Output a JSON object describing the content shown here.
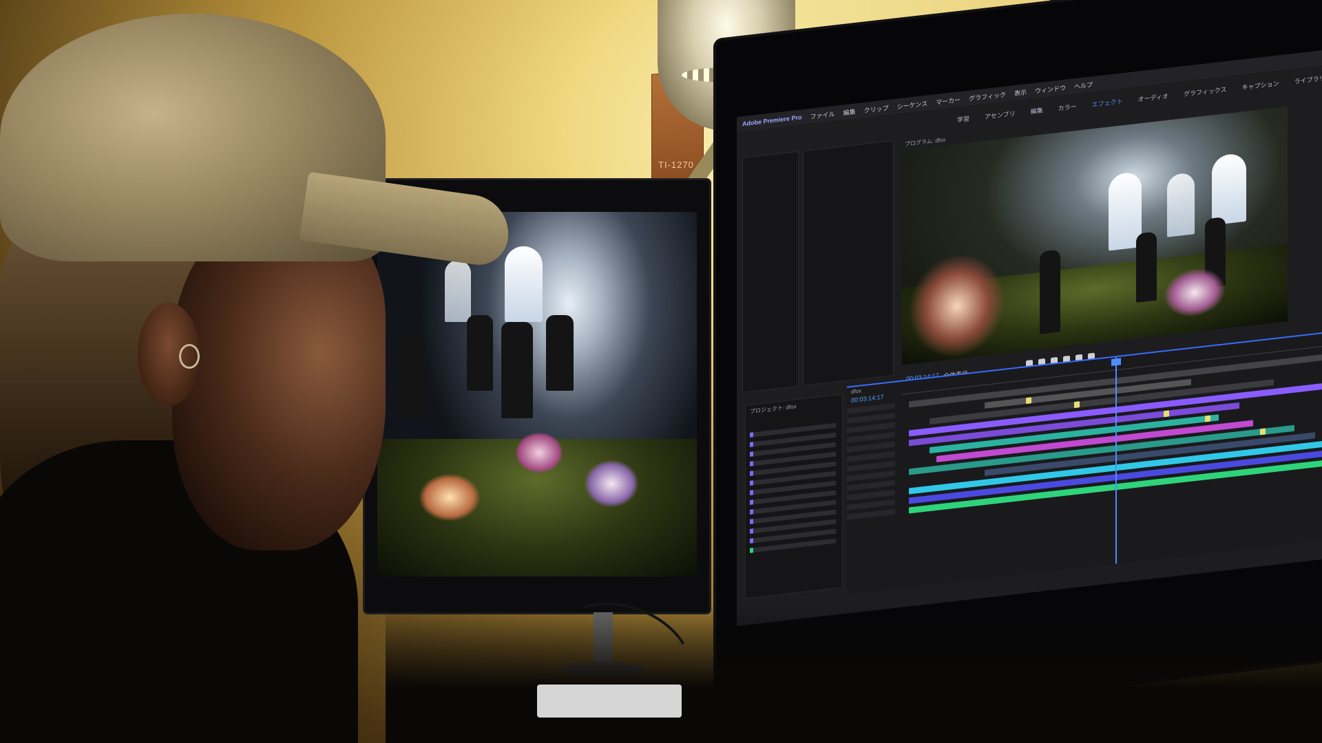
{
  "poster": {
    "code": "TI-1270"
  },
  "editor": {
    "app_name": "Adobe Premiere Pro",
    "menu": [
      "ファイル",
      "編集",
      "クリップ",
      "シーケンス",
      "マーカー",
      "グラフィック",
      "表示",
      "ウィンドウ",
      "ヘルプ"
    ],
    "workspace_tabs": [
      "学習",
      "アセンブリ",
      "編集",
      "カラー",
      "エフェクト",
      "オーディオ",
      "グラフィックス",
      "キャプション",
      "ライブラリ"
    ],
    "active_workspace": "エフェクト",
    "program_label": "プログラム: dfox",
    "sequence_tab": "dfox",
    "program_timecode": "00:03:14:17",
    "timeline_timecode": "00:03:14:17",
    "project_label": "プロジェクト: dfox",
    "fit_label": "全体表示"
  },
  "colors": {
    "timeline_accent": "#4f8cff",
    "clip_purple": "#8a5cff",
    "clip_teal": "#2bb3a0",
    "clip_magenta": "#c04ad0",
    "clip_cyan": "#31c8e8",
    "clip_green": "#2ed47a",
    "clip_yellow": "#e8e070"
  }
}
